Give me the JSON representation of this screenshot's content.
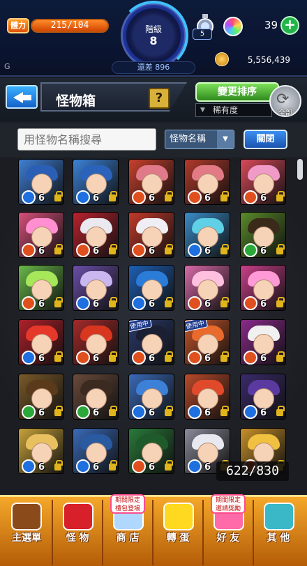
{
  "status": {
    "stamina_label": "體力",
    "stamina_text": "215/104",
    "stamina_fraction": 1.0,
    "rank_label": "階級",
    "rank_value": "8",
    "rank_diff": "還差 896",
    "potion_count": "5",
    "orb_count": "39",
    "g_label": "G",
    "coin_value": "5,556,439"
  },
  "header": {
    "title": "怪物箱",
    "help_label": "?",
    "sort_label": "變更排序",
    "rarity_label": "稀有度",
    "all_label": "全部"
  },
  "search": {
    "placeholder": "用怪物名稱搜尋",
    "select_value": "怪物名稱",
    "close_label": "關閉"
  },
  "grid": {
    "cells": [
      {
        "level": "6",
        "element": "water",
        "color": "#3f7fd6",
        "hair": "#2a5fb5"
      },
      {
        "level": "6",
        "element": "water",
        "color": "#3b82d8",
        "hair": "#2a63b9"
      },
      {
        "level": "6",
        "element": "fire",
        "color": "#c9402d",
        "hair": "#e07a8a"
      },
      {
        "level": "6",
        "element": "fire",
        "color": "#b23a2c",
        "hair": "#e27a86"
      },
      {
        "level": "6",
        "element": "fire",
        "color": "#d84a5a",
        "hair": "#f09ac8"
      },
      {
        "level": "6",
        "element": "fire",
        "color": "#d6507a",
        "hair": "#ff8fd0"
      },
      {
        "level": "6",
        "element": "fire",
        "color": "#b8222e",
        "hair": "#e9e9ef"
      },
      {
        "level": "6",
        "element": "fire",
        "color": "#c23a2a",
        "hair": "#f0eef5"
      },
      {
        "level": "6",
        "element": "water",
        "color": "#3a8cc8",
        "hair": "#5fd0e6"
      },
      {
        "level": "6",
        "element": "wood",
        "color": "#5a8a2a",
        "hair": "#3a2a1a"
      },
      {
        "level": "6",
        "element": "fire",
        "color": "#69b84a",
        "hair": "#a6e85a"
      },
      {
        "level": "6",
        "element": "water",
        "color": "#6a4fa8",
        "hair": "#c9b7f0"
      },
      {
        "level": "6",
        "element": "water",
        "color": "#1e5fb5",
        "hair": "#2a7cd8"
      },
      {
        "level": "6",
        "element": "fire",
        "color": "#d86aa8",
        "hair": "#ffc0e0"
      },
      {
        "level": "6",
        "element": "fire",
        "color": "#c9408a",
        "hair": "#ff9ad6"
      },
      {
        "level": "6",
        "element": "water",
        "color": "#b0202a",
        "hair": "#e6382a"
      },
      {
        "level": "6",
        "element": "fire",
        "color": "#a52a2a",
        "hair": "#d9361f"
      },
      {
        "level": "6",
        "element": "fire",
        "color": "#2a3a6a",
        "hair": "#1a1f33",
        "in_use": true
      },
      {
        "level": "6",
        "element": "fire",
        "color": "#c8562a",
        "hair": "#e86a2c",
        "in_use": true
      },
      {
        "level": "6",
        "element": "fire",
        "color": "#8a2a8a",
        "hair": "#f0f0f0"
      },
      {
        "level": "6",
        "element": "wood",
        "color": "#7a5a2a",
        "hair": "#5a3a1a"
      },
      {
        "level": "6",
        "element": "wood",
        "color": "#6a4a3a",
        "hair": "#3a2a20"
      },
      {
        "level": "6",
        "element": "water",
        "color": "#3a6ab8",
        "hair": "#3c80d8"
      },
      {
        "level": "6",
        "element": "water",
        "color": "#b84a2a",
        "hair": "#e04a2a"
      },
      {
        "level": "6",
        "element": "water",
        "color": "#3a2a6a",
        "hair": "#5a3aa0"
      },
      {
        "level": "6",
        "element": "water",
        "color": "#c8a23a",
        "hair": "#e8c060"
      },
      {
        "level": "6",
        "element": "water",
        "color": "#3a6ab8",
        "hair": "#2a5aa0"
      },
      {
        "level": "6",
        "element": "fire",
        "color": "#2a7a3a",
        "hair": "#1f5a2a"
      },
      {
        "level": "6",
        "element": "water",
        "color": "#8a8a9a",
        "hair": "#e8e8f0"
      },
      {
        "level": "6",
        "element": "fire",
        "color": "#c8902a",
        "hair": "#f0c040"
      }
    ],
    "count_text": "622/830"
  },
  "nav": {
    "items": [
      {
        "label": "主選單",
        "color": "#8a4a1a"
      },
      {
        "label": "怪 物",
        "color": "#d8202a"
      },
      {
        "label": "商 店",
        "color": "#b0d8ff",
        "promo": "期間限定\n禮包登場"
      },
      {
        "label": "轉 蛋",
        "color": "#ffd820"
      },
      {
        "label": "好 友",
        "color": "#ff6aa8",
        "promo": "期間限定\n邀請獎勵"
      },
      {
        "label": "其 他",
        "color": "#3ab8c8"
      }
    ]
  }
}
